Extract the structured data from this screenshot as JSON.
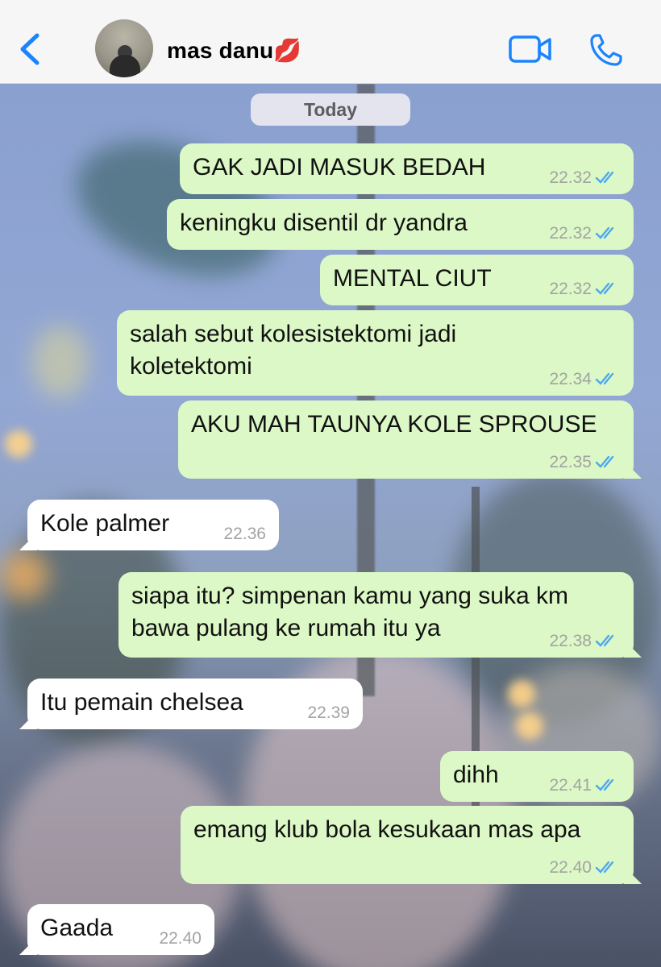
{
  "header": {
    "back_icon": "chevron-left-icon",
    "contact_name": "mas danu",
    "contact_emoji": "💋",
    "video_icon": "video-camera-icon",
    "call_icon": "phone-icon",
    "accent_color": "#1a84ff"
  },
  "chat": {
    "date_label": "Today",
    "colors": {
      "outgoing": "#dcf8c6",
      "incoming": "#ffffff",
      "read_ticks": "#4fa8ec"
    },
    "messages": [
      {
        "direction": "out",
        "text": "GAK JADI MASUK BEDAH",
        "time": "22.32",
        "status": "read"
      },
      {
        "direction": "out",
        "text": "keningku disentil dr yandra",
        "time": "22.32",
        "status": "read"
      },
      {
        "direction": "out",
        "text": "MENTAL CIUT",
        "time": "22.32",
        "status": "read"
      },
      {
        "direction": "out",
        "text": "salah sebut kolesistektomi jadi koletektomi",
        "time": "22.34",
        "status": "read"
      },
      {
        "direction": "out",
        "text": "AKU MAH TAUNYA KOLE SPROUSE",
        "time": "22.35",
        "status": "read"
      },
      {
        "direction": "in",
        "text": "Kole palmer",
        "time": "22.36"
      },
      {
        "direction": "out",
        "text": "siapa itu? simpenan kamu yang suka km bawa pulang ke rumah itu ya",
        "time": "22.38",
        "status": "read"
      },
      {
        "direction": "in",
        "text": "Itu pemain chelsea",
        "time": "22.39"
      },
      {
        "direction": "out",
        "text": "dihh",
        "time": "22.41",
        "status": "read"
      },
      {
        "direction": "out",
        "text": "emang klub bola kesukaan mas apa",
        "time": "22.40",
        "status": "read"
      },
      {
        "direction": "in",
        "text": "Gaada",
        "time": "22.40"
      }
    ]
  }
}
